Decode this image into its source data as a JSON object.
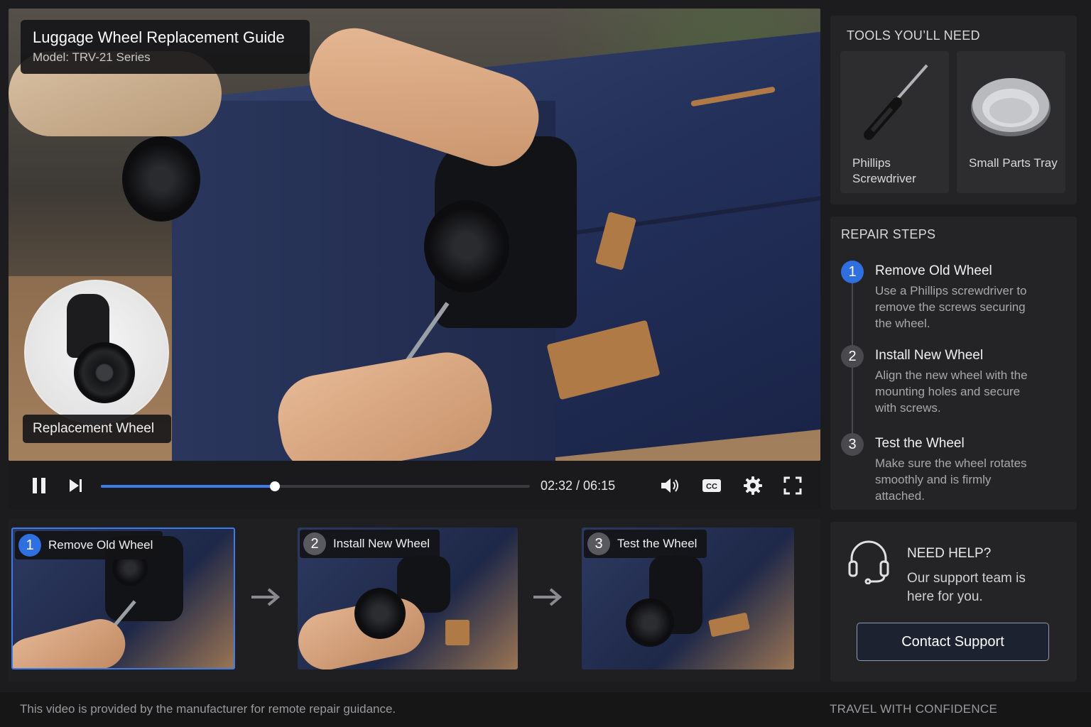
{
  "video": {
    "title": "Luggage Wheel Replacement Guide",
    "subtitle": "Model: TRV-21 Series",
    "inset_label": "Replacement Wheel"
  },
  "player": {
    "current_time": "02:32",
    "duration": "06:15",
    "time_display": "02:32 / 06:15",
    "progress_fraction": 0.4053,
    "icons": [
      "pause-icon",
      "skip-next-icon",
      "volume-icon",
      "cc-icon",
      "settings-icon",
      "fullscreen-icon"
    ]
  },
  "tools": {
    "title": "TOOLS YOU’LL NEED",
    "items": [
      {
        "name": "Phillips Screwdriver",
        "icon": "screwdriver-icon"
      },
      {
        "name": "Small Parts Tray",
        "icon": "tray-icon"
      }
    ]
  },
  "repair_steps": {
    "title": "REPAIR STEPS",
    "steps": [
      {
        "number": "1",
        "name": "Remove Old Wheel",
        "description": "Use a Phillips screwdriver to remove the screws securing the wheel.",
        "active": true
      },
      {
        "number": "2",
        "name": "Install New Wheel",
        "description": "Align the new wheel with the mounting holes and secure with screws.",
        "active": false
      },
      {
        "number": "3",
        "name": "Test the Wheel",
        "description": "Make sure the wheel rotates smoothly and is firmly attached.",
        "active": false
      }
    ]
  },
  "chapters": [
    {
      "number": "1",
      "label": "Remove Old Wheel",
      "active": true
    },
    {
      "number": "2",
      "label": "Install New Wheel",
      "active": false
    },
    {
      "number": "3",
      "label": "Test the Wheel",
      "active": false
    }
  ],
  "help": {
    "title": "NEED HELP?",
    "description": "Our support team is here for you.",
    "button_label": "Contact Support",
    "icon": "headset-icon"
  },
  "footer": {
    "disclaimer": "This video is provided by the manufacturer for remote repair guidance.",
    "tagline": "TRAVEL WITH CONFIDENCE"
  },
  "colors": {
    "accent": "#2f6fe0",
    "background": "#1c1c1e",
    "panel": "#242426"
  }
}
